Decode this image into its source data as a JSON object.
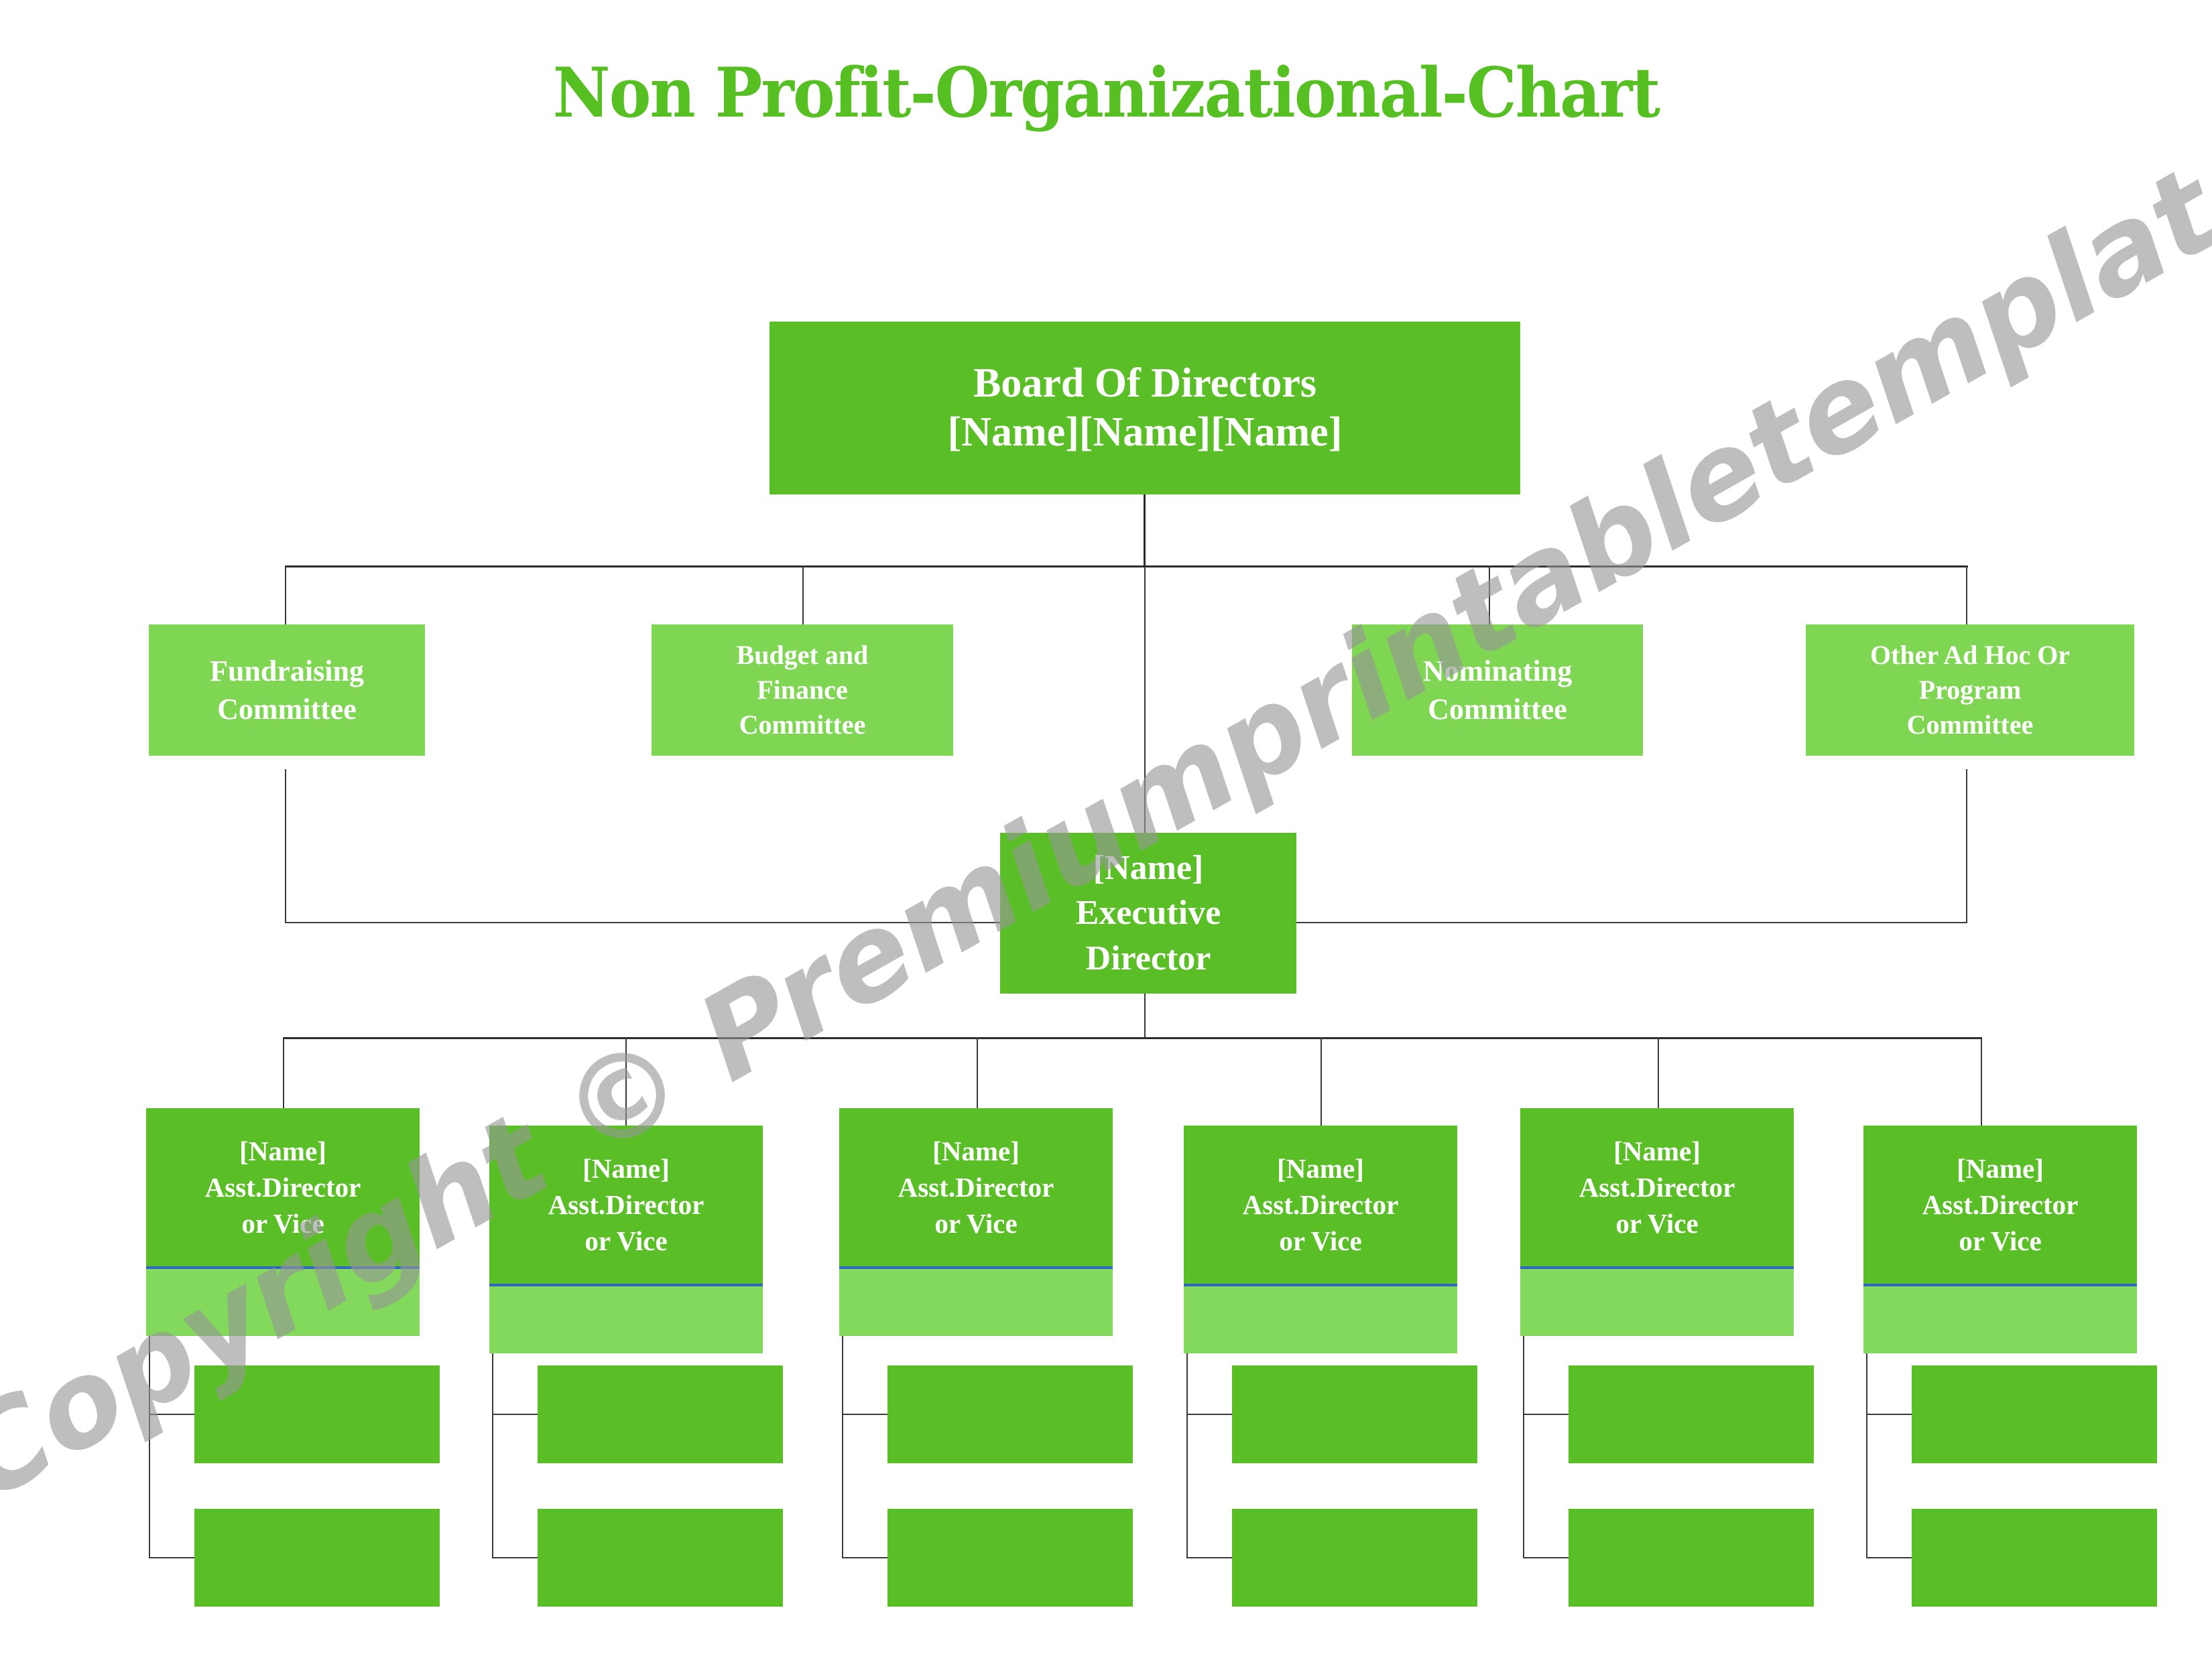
{
  "document": {
    "title": "Non Profit-Organizational-Chart",
    "watermark": "Copyright © Premiumprintabletemplates.com"
  },
  "colors": {
    "title_green": "#56bf22",
    "node_dark_green": "#5abf26",
    "node_light_green": "#7fd653",
    "asst_body_green": "#82d95c",
    "asst_rule_blue": "#2f68c4",
    "connector": "#2b2b2b",
    "text_on_node": "#ffffff",
    "watermark_gray": "#969696",
    "background": "#ffffff"
  },
  "chart_data": {
    "type": "diagram",
    "diagram_type": "organizational-chart",
    "title": "Non Profit-Organizational-Chart",
    "levels": 4,
    "nodes": [
      {
        "id": "board",
        "level": 0,
        "lines": [
          "Board Of Directors",
          "[Name][Name][Name]"
        ],
        "style": "dark"
      },
      {
        "id": "committee-fundraising",
        "level": 1,
        "lines": [
          "Fundraising",
          "Committee"
        ],
        "style": "light",
        "parent": "board"
      },
      {
        "id": "committee-budget-finance",
        "level": 1,
        "lines": [
          "Budget and",
          "Finance",
          "Committee"
        ],
        "style": "light",
        "parent": "board"
      },
      {
        "id": "committee-nominating",
        "level": 1,
        "lines": [
          "Nominating",
          "Committee"
        ],
        "style": "light",
        "parent": "board"
      },
      {
        "id": "committee-other-ad-hoc",
        "level": 1,
        "lines": [
          "Other Ad Hoc Or",
          "Program",
          "Committee"
        ],
        "style": "light",
        "parent": "board"
      },
      {
        "id": "executive-director",
        "level": 2,
        "lines": [
          "[Name]",
          "Executive",
          "Director"
        ],
        "style": "dark",
        "parent": "board"
      },
      {
        "id": "asst-1",
        "level": 3,
        "lines": [
          "[Name]",
          "Asst.Director",
          "or Vice"
        ],
        "style": "dark-over-light",
        "parent": "executive-director",
        "children_count": 2
      },
      {
        "id": "asst-2",
        "level": 3,
        "lines": [
          "[Name]",
          "Asst.Director",
          "or Vice"
        ],
        "style": "dark-over-light",
        "parent": "executive-director",
        "children_count": 2
      },
      {
        "id": "asst-3",
        "level": 3,
        "lines": [
          "[Name]",
          "Asst.Director",
          "or Vice"
        ],
        "style": "dark-over-light",
        "parent": "executive-director",
        "children_count": 2
      },
      {
        "id": "asst-4",
        "level": 3,
        "lines": [
          "[Name]",
          "Asst.Director",
          "or Vice"
        ],
        "style": "dark-over-light",
        "parent": "executive-director",
        "children_count": 2
      },
      {
        "id": "asst-5",
        "level": 3,
        "lines": [
          "[Name]",
          "Asst.Director",
          "or Vice"
        ],
        "style": "dark-over-light",
        "parent": "executive-director",
        "children_count": 2
      },
      {
        "id": "asst-6",
        "level": 3,
        "lines": [
          "[Name]",
          "Asst.Director",
          "or Vice"
        ],
        "style": "dark-over-light",
        "parent": "executive-director",
        "children_count": 2
      }
    ]
  },
  "board": {
    "line1": "Board Of Directors",
    "line2": "[Name][Name][Name]"
  },
  "committees": [
    {
      "line1": "Fundraising",
      "line2": "Committee",
      "line3": ""
    },
    {
      "line1": "Budget and",
      "line2": "Finance",
      "line3": "Committee"
    },
    {
      "line1": "Nominating",
      "line2": "Committee",
      "line3": ""
    },
    {
      "line1": "Other Ad Hoc Or",
      "line2": "Program",
      "line3": "Committee"
    }
  ],
  "executive": {
    "line1": "[Name]",
    "line2": "Executive",
    "line3": "Director"
  },
  "assistants": [
    {
      "line1": "[Name]",
      "line2": "Asst.Director",
      "line3": "or Vice"
    },
    {
      "line1": "[Name]",
      "line2": "Asst.Director",
      "line3": "or Vice"
    },
    {
      "line1": "[Name]",
      "line2": "Asst.Director",
      "line3": "or Vice"
    },
    {
      "line1": "[Name]",
      "line2": "Asst.Director",
      "line3": "or Vice"
    },
    {
      "line1": "[Name]",
      "line2": "Asst.Director",
      "line3": "or Vice"
    },
    {
      "line1": "[Name]",
      "line2": "Asst.Director",
      "line3": "or Vice"
    }
  ],
  "leaf_boxes": {
    "count_per_assistant": 2,
    "label": ""
  }
}
